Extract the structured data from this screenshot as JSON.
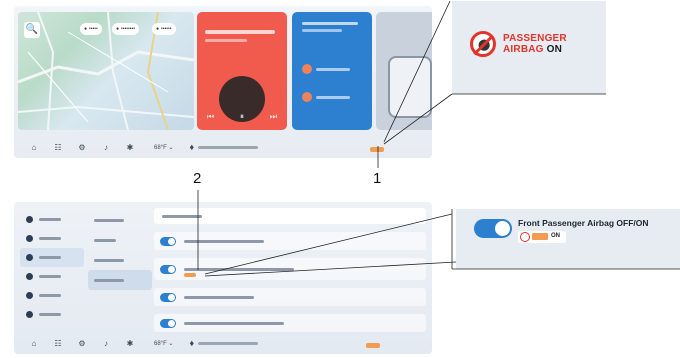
{
  "callouts": {
    "one": "1",
    "two": "2"
  },
  "top_screen": {
    "chips": [
      "•••••",
      "••••••••",
      "••••••"
    ],
    "media_controls": [
      "⏮",
      "⏸",
      "⏭"
    ],
    "bottom_icons": [
      "⌂",
      "☷",
      "⚙",
      "♪",
      "✱"
    ],
    "temperature": "68°F ⌄"
  },
  "zoom_top": {
    "line1": "PASSENGER",
    "line2_red": "AIRBAG",
    "line2_black": "ON"
  },
  "zoom_bottom": {
    "label": "Front Passenger Airbag OFF/ON",
    "badge_text": "ON"
  },
  "colors": {
    "accent": "#2d7fd0",
    "airbag_red": "#e2342a",
    "airbag_orange": "#f29b52"
  },
  "icons": {
    "map_search": "🔍",
    "passenger": "⬤"
  }
}
